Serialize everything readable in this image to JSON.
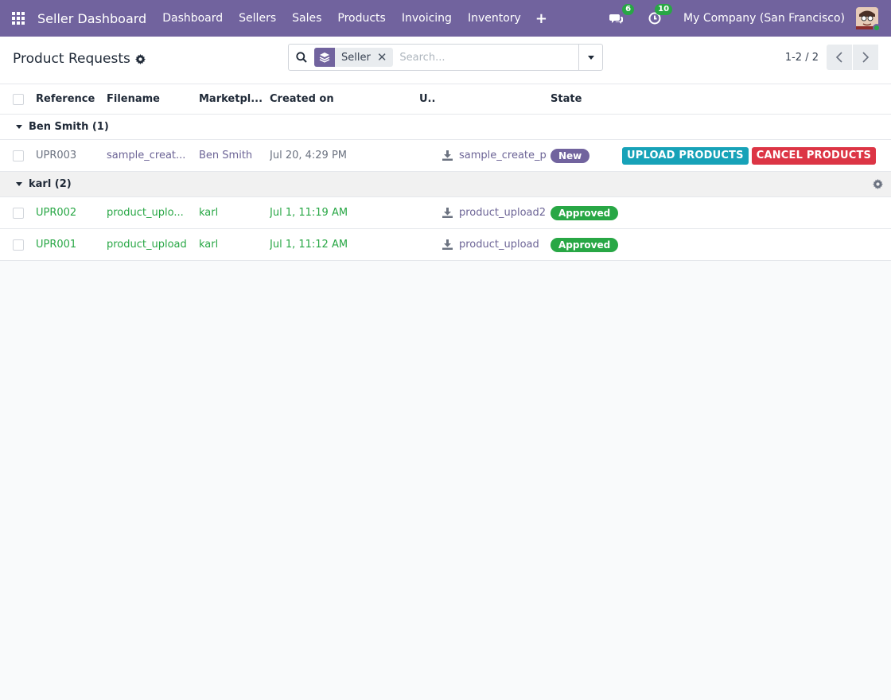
{
  "navbar": {
    "brand": "Seller Dashboard",
    "menu": [
      "Dashboard",
      "Sellers",
      "Sales",
      "Products",
      "Invoicing",
      "Inventory"
    ],
    "plus": "+",
    "messages_count": "6",
    "activities_count": "10",
    "company": "My Company (San Francisco)"
  },
  "control_panel": {
    "title": "Product Requests",
    "facet_label": "Seller",
    "search_placeholder": "Search...",
    "pager": "1-2 / 2"
  },
  "columns": {
    "reference": "Reference",
    "filename": "Filename",
    "marketplace": "Marketpl...",
    "created_on": "Created on",
    "upload": "U..",
    "state": "State"
  },
  "groups": [
    {
      "label": "Ben Smith (1)",
      "rows": [
        {
          "reference": "UPR003",
          "filename": "sample_creat...",
          "marketplace": "Ben Smith",
          "created_on": "Jul 20, 4:29 PM",
          "file": "sample_create_pr",
          "state": "New",
          "upload_label": "UPLOAD PRODUCTS",
          "cancel_label": "CANCEL PRODUCTS"
        }
      ]
    },
    {
      "label": "karl (2)",
      "rows": [
        {
          "reference": "UPR002",
          "filename": "product_uplo...",
          "marketplace": "karl",
          "created_on": "Jul 1, 11:19 AM",
          "file": "product_upload2",
          "state": "Approved"
        },
        {
          "reference": "UPR001",
          "filename": "product_upload",
          "marketplace": "karl",
          "created_on": "Jul 1, 11:12 AM",
          "file": "product_upload",
          "state": "Approved"
        }
      ]
    }
  ],
  "colors": {
    "navbar": "#71639e",
    "approved": "#28a745",
    "upload_button": "#17a2b8",
    "cancel_button": "#dc3545"
  },
  "icons": [
    "apps-grid-icon",
    "chat-icon",
    "clock-icon",
    "gear-icon",
    "search-icon",
    "layers-icon",
    "close-icon",
    "caret-down-icon",
    "chevron-left-icon",
    "chevron-right-icon",
    "download-icon"
  ]
}
